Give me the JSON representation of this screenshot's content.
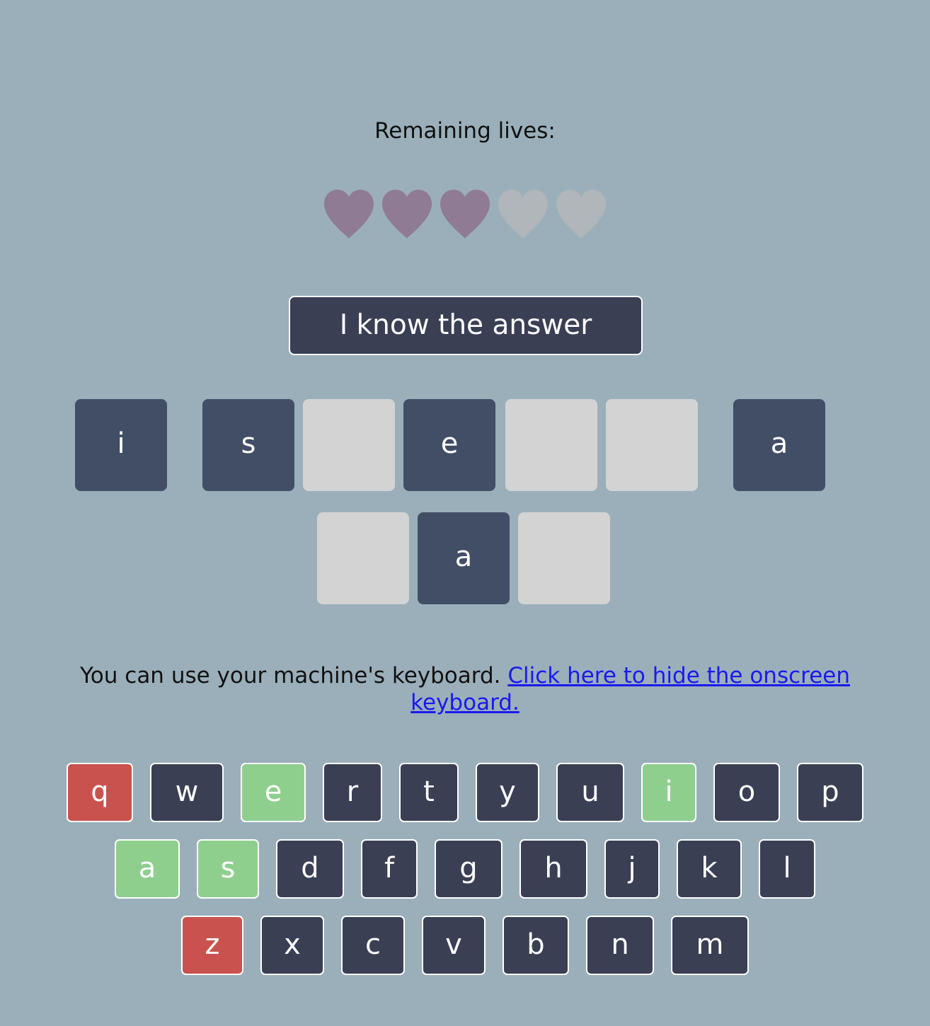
{
  "lives": {
    "label": "Remaining lives:",
    "total": 5,
    "remaining": 3,
    "active_color": "#8f7b94",
    "lost_color": "#b0b6ba"
  },
  "answer_button": {
    "label": "I know the answer"
  },
  "puzzle": {
    "words": [
      [
        "i"
      ],
      [
        "s",
        "",
        "e",
        "",
        ""
      ],
      [
        "a"
      ],
      [
        "",
        "a",
        ""
      ]
    ]
  },
  "hint": {
    "text": "You can use your machine's keyboard.",
    "link": "Click here to hide the onscreen keyboard."
  },
  "keyboard": {
    "rows": [
      [
        {
          "key": "q",
          "state": "wrong"
        },
        {
          "key": "w",
          "state": "unused"
        },
        {
          "key": "e",
          "state": "correct"
        },
        {
          "key": "r",
          "state": "unused"
        },
        {
          "key": "t",
          "state": "unused"
        },
        {
          "key": "y",
          "state": "unused"
        },
        {
          "key": "u",
          "state": "unused"
        },
        {
          "key": "i",
          "state": "correct"
        },
        {
          "key": "o",
          "state": "unused"
        },
        {
          "key": "p",
          "state": "unused"
        }
      ],
      [
        {
          "key": "a",
          "state": "correct"
        },
        {
          "key": "s",
          "state": "correct"
        },
        {
          "key": "d",
          "state": "unused"
        },
        {
          "key": "f",
          "state": "unused"
        },
        {
          "key": "g",
          "state": "unused"
        },
        {
          "key": "h",
          "state": "unused"
        },
        {
          "key": "j",
          "state": "unused"
        },
        {
          "key": "k",
          "state": "unused"
        },
        {
          "key": "l",
          "state": "unused"
        }
      ],
      [
        {
          "key": "z",
          "state": "wrong"
        },
        {
          "key": "x",
          "state": "unused"
        },
        {
          "key": "c",
          "state": "unused"
        },
        {
          "key": "v",
          "state": "unused"
        },
        {
          "key": "b",
          "state": "unused"
        },
        {
          "key": "n",
          "state": "unused"
        },
        {
          "key": "m",
          "state": "unused"
        }
      ]
    ],
    "colors": {
      "unused": "#3a3f54",
      "correct": "#8fcf8e",
      "wrong": "#c9524e"
    }
  }
}
